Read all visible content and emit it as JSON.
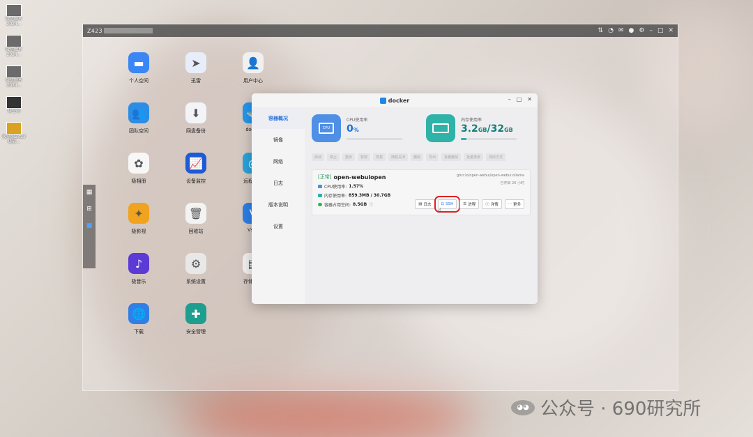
{
  "desktop": {
    "shortcuts": [
      {
        "label": "微信图片 2024..."
      },
      {
        "label": "微信图片 2024..."
      },
      {
        "label": "微信图片 2024..."
      },
      {
        "label": "极空间"
      },
      {
        "label": "极空间Z423 极影..."
      }
    ]
  },
  "nas": {
    "title": "Z423",
    "tools": [
      "⇅",
      "◔",
      "✉",
      "●",
      "⚙",
      "–",
      "□",
      "✕"
    ],
    "apps": [
      {
        "name": "个人空间",
        "icon": "folder-icon",
        "color": "#3a86f5",
        "glyph": "▬"
      },
      {
        "name": "迅雷",
        "icon": "bird-icon",
        "color": "#e8eef9",
        "glyph": "➤"
      },
      {
        "name": "用户中心",
        "icon": "user-icon",
        "color": "#f0f0f0",
        "glyph": "👤"
      },
      {
        "name": "团队空间",
        "icon": "team-folder-icon",
        "color": "#2b8ee6",
        "glyph": "👥"
      },
      {
        "name": "网盘备份",
        "icon": "cloud-download-icon",
        "color": "#f2f4f8",
        "glyph": "⬇"
      },
      {
        "name": "docker",
        "icon": "docker-icon",
        "color": "#2496ed",
        "glyph": "🐳"
      },
      {
        "name": "极相册",
        "icon": "photos-icon",
        "color": "#f7f7f7",
        "glyph": "✿"
      },
      {
        "name": "设备监控",
        "icon": "monitor-icon",
        "color": "#1f5ad6",
        "glyph": "📈"
      },
      {
        "name": "远程访问",
        "icon": "remote-icon",
        "color": "#2aa3d8",
        "glyph": "◎"
      },
      {
        "name": "极影视",
        "icon": "film-icon",
        "color": "#f0a31e",
        "glyph": "✦"
      },
      {
        "name": "回收站",
        "icon": "trash-icon",
        "color": "#f3f3f3",
        "glyph": "🗑"
      },
      {
        "name": "Vsftp",
        "icon": "ftp-icon",
        "color": "#2b7fe6",
        "glyph": "V"
      },
      {
        "name": "极音乐",
        "icon": "music-icon",
        "color": "#5c3ad6",
        "glyph": "♪"
      },
      {
        "name": "系统设置",
        "icon": "settings-icon",
        "color": "#e8e8e8",
        "glyph": "⚙"
      },
      {
        "name": "存储管理",
        "icon": "storage-icon",
        "color": "#f0f0f0",
        "glyph": "▤"
      },
      {
        "name": "下载",
        "icon": "globe-download-icon",
        "color": "#2f7fe6",
        "glyph": "🌐"
      },
      {
        "name": "安全管理",
        "icon": "shield-icon",
        "color": "#1d9e8e",
        "glyph": "✚"
      }
    ]
  },
  "docker": {
    "title": "docker",
    "controls": [
      "–",
      "□",
      "✕"
    ],
    "nav": [
      "容器概况",
      "镜像",
      "网络",
      "日志",
      "版本说明",
      "设置"
    ],
    "cpu": {
      "label": "CPU使用率",
      "value": "0",
      "unit": "%",
      "chip": "CPU"
    },
    "mem": {
      "label": "内存使用率",
      "used": "3.2",
      "used_unit": "GB",
      "sep": "/",
      "total": "32",
      "total_unit": "GB",
      "fraction": 0.1
    },
    "toolbar": [
      "启动",
      "停止",
      "重启",
      "暂停",
      "恢复",
      "随机关闭",
      "删除",
      "导出",
      "批量删除",
      "批量排序",
      "排序方式"
    ],
    "container": {
      "status": "[正常]",
      "name": "open-webuiopen",
      "image": "ghcr.io/open-webui/open-webui:ollama",
      "uptime": "已开启 26 小时",
      "cpu_label": "CPU使用率:",
      "cpu_value": "1.57%",
      "mem_label": "内存使用率:",
      "mem_value": "859.3MB / 30.7GB",
      "disk_label": "容器占用空间:",
      "disk_value": "8.5GB",
      "actions": {
        "log": "日志",
        "ssh": "SSH",
        "process": "进程",
        "detail": "详情",
        "more": "更多"
      }
    }
  },
  "watermark": {
    "text": "公众号 · 690研究所"
  }
}
